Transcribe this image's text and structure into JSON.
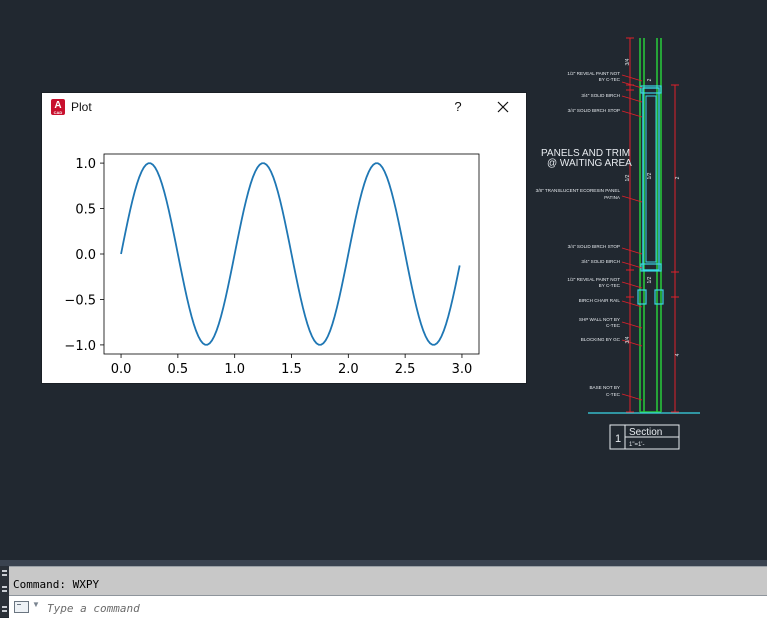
{
  "plot_window": {
    "title": "Plot",
    "app_icon_letter": "A",
    "app_icon_sub": "CAD",
    "help_label": "?",
    "close_icon": "close-icon"
  },
  "chart_data": {
    "type": "line",
    "title": "",
    "xlabel": "",
    "ylabel": "",
    "function": "sin(2*pi*x)",
    "xlim": [
      -0.15,
      3.15
    ],
    "ylim": [
      -1.1,
      1.1
    ],
    "x_ticks": [
      "0.0",
      "0.5",
      "1.0",
      "1.5",
      "2.0",
      "2.5",
      "3.0"
    ],
    "y_ticks": [
      "1.0",
      "0.5",
      "0.0",
      "−0.5",
      "−1.0"
    ],
    "series": [
      {
        "color": "#1f77b4",
        "x_start": 0.0,
        "x_end": 2.98,
        "x_step": 0.02
      }
    ]
  },
  "drawing": {
    "title_text": "PANELS AND TRIM",
    "subtitle_text": "@ WAITING AREA",
    "section_number": "1",
    "section_label": "Section",
    "section_scale": "1\"=1'-",
    "callouts_left": [
      "1/2\" REVEAL PAINT NOT",
      "BY C-TEC",
      "3/4\" SOLID BIRCH",
      "3/4\" SOLID BIRCH STOP",
      "3/8\" TRANSLUCENT ECORESIN PANEL",
      "PATINA",
      "3/4\" SOLID BIRCH STOP",
      "3/4\" SOLID BIRCH",
      "1/2\" REVEAL PAINT NOT",
      "BY C-TEC",
      "BIRCH CHAIR RAIL",
      "SHP WALL NOT BY",
      "C-TEC",
      "BLOCKING BY GC",
      "BASE NOT BY",
      "C-TEC"
    ],
    "dims": [
      "3/4",
      "2",
      "1/2",
      "1/2",
      "2",
      "1/2",
      "3/4",
      "4"
    ],
    "colors": {
      "background": "#212830",
      "red": "#e0202a",
      "green": "#27c43a",
      "cyan": "#3ad6e6",
      "white": "#e8ecf0"
    }
  },
  "command": {
    "history_text": "Command: WXPY",
    "placeholder": "Type a command"
  }
}
